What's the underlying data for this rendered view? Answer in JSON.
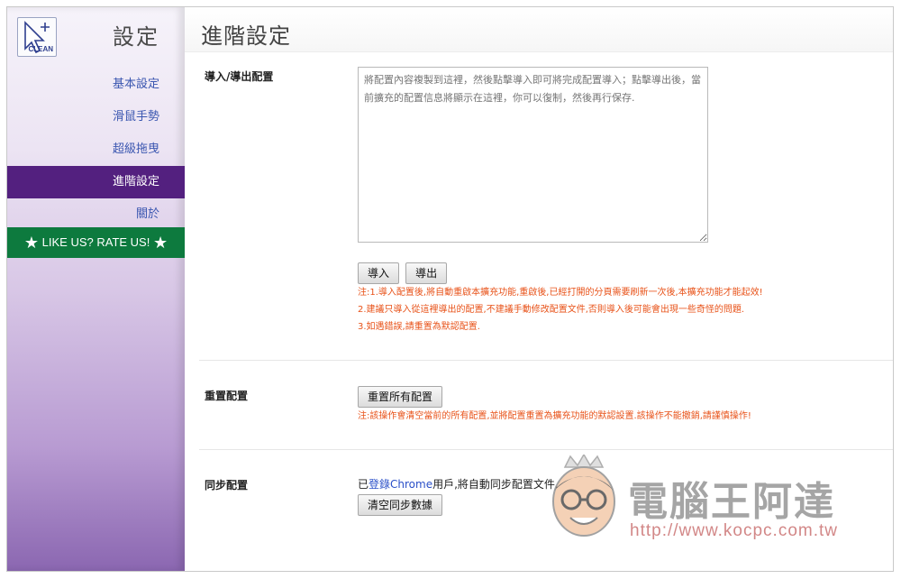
{
  "sidebar": {
    "logo_text": "CLEAN",
    "title": "設定",
    "items": [
      {
        "label": "基本設定"
      },
      {
        "label": "滑鼠手勢"
      },
      {
        "label": "超級拖曳"
      },
      {
        "label": "進階設定"
      },
      {
        "label": "關於"
      }
    ],
    "rate_label": "LIKE US? RATE US!",
    "active_color": "#53207f",
    "rate_color": "#0d7a3e"
  },
  "main": {
    "title": "進階設定",
    "import_export": {
      "label": "導入/導出配置",
      "placeholder": "將配置內容複製到這裡，然後點擊導入即可將完成配置導入；點擊導出後，當前擴充的配置信息將顯示在這裡，你可以復制，然後再行保存.",
      "import_button": "導入",
      "export_button": "導出",
      "notes": [
        "注:1.導入配置後,將自動重啟本擴充功能,重啟後,已經打開的分頁需要刷新一次後,本擴充功能才能起效!",
        "2.建議只導入從這裡導出的配置,不建議手動修改配置文件,否則導入後可能會出現一些奇怪的問題.",
        "3.如遇錯誤,請重置為默認配置."
      ]
    },
    "reset": {
      "label": "重置配置",
      "button": "重置所有配置",
      "note": "注:該操作會清空當前的所有配置,並將配置重置為擴充功能的默認設置.該操作不能撤銷,請謹慎操作!"
    },
    "sync": {
      "label": "同步配置",
      "text_before": "已",
      "link": "登錄Chrome",
      "text_after": "用戶,將自動同步配置文件.",
      "button": "清空同步數據"
    }
  },
  "watermark": {
    "title": "電腦王阿達",
    "url": "http://www.kocpc.com.tw"
  },
  "colors": {
    "note": "#e8531a",
    "link": "#3a56b0"
  }
}
